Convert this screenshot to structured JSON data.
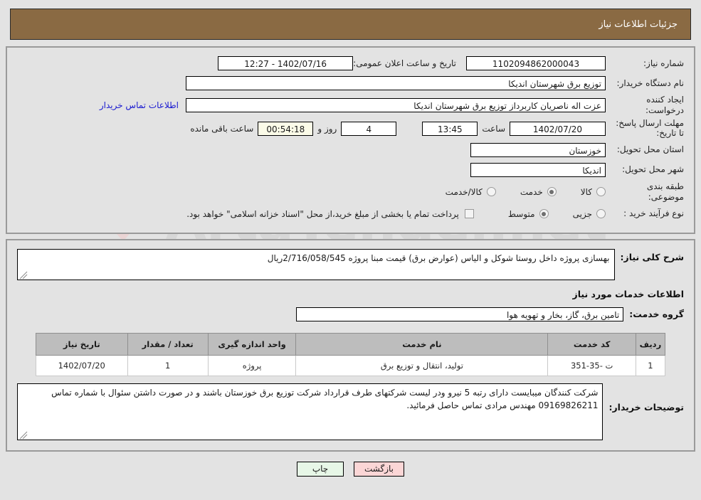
{
  "header": {
    "title": "جزئیات اطلاعات نیاز"
  },
  "watermark": {
    "text": "ArtaTender.net"
  },
  "form": {
    "need_number": {
      "label": "شماره نیاز:",
      "value": "1102094862000043"
    },
    "public_announce": {
      "label": "تاریخ و ساعت اعلان عمومی:",
      "value": "1402/07/16 - 12:27"
    },
    "buyer_org": {
      "label": "نام دستگاه خریدار:",
      "value": "توزیع برق شهرستان اندیکا"
    },
    "requester": {
      "label": "ایجاد کننده درخواست:",
      "value": "عزت اله ناصریان کاربرداز توزیع برق شهرستان اندیکا"
    },
    "contact_link": "اطلاعات تماس خریدار",
    "deadline": {
      "label": "مهلت ارسال پاسخ: تا تاریخ:",
      "date": "1402/07/20",
      "time_label": "ساعت",
      "time": "13:45",
      "days": "4",
      "days_label": "روز و",
      "countdown": "00:54:18",
      "remaining_label": "ساعت باقی مانده"
    },
    "province": {
      "label": "استان محل تحویل:",
      "value": "خوزستان"
    },
    "city": {
      "label": "شهر محل تحویل:",
      "value": "اندیکا"
    },
    "category": {
      "label": "طبقه بندی موضوعی:",
      "options": [
        {
          "label": "کالا",
          "selected": false
        },
        {
          "label": "خدمت",
          "selected": true
        },
        {
          "label": "کالا/خدمت",
          "selected": false
        }
      ]
    },
    "process_type": {
      "label": "نوع فرآیند خرید :",
      "options": [
        {
          "label": "جزیی",
          "selected": false
        },
        {
          "label": "متوسط",
          "selected": true
        }
      ],
      "checkbox_checked": false,
      "checkbox_text": "پرداخت تمام یا بخشی از مبلغ خرید،از محل \"اسناد خزانه اسلامی\" خواهد بود."
    }
  },
  "description": {
    "label": "شرح کلی نیاز:",
    "value": "بهسازی پروژه داخل روستا شوکل و الیاس (عوارض برق) قیمت مبنا پروژه 2/716/058/545ریال"
  },
  "services_section": {
    "title": "اطلاعات خدمات مورد نیاز",
    "group_label": "گروه خدمت:",
    "group_value": "تامین برق، گاز، بخار و تهویه هوا"
  },
  "table": {
    "columns": [
      "ردیف",
      "کد خدمت",
      "نام خدمت",
      "واحد اندازه گیری",
      "تعداد / مقدار",
      "تاریخ نیاز"
    ],
    "rows": [
      {
        "radif": "1",
        "code": "ت -35-351",
        "name": "تولید، انتقال و توزیع برق",
        "unit": "پروژه",
        "qty": "1",
        "date": "1402/07/20"
      }
    ]
  },
  "notes": {
    "label": "توضیحات خریدار:",
    "value": "شرکت کنندگان میبایست دارای رتبه 5 نیرو  ودر لیست شرکتهای طرف قرارداد شرکت توزیع برق خوزستان باشند و در صورت داشتن سئوال با شماره تماس 09169826211 مهندس مرادی تماس حاصل فرمائید."
  },
  "footer": {
    "print_label": "چاپ",
    "back_label": "بازگشت"
  }
}
